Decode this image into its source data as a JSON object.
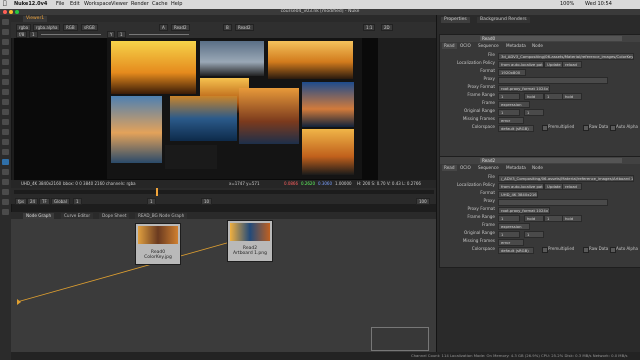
{
  "menubar": {
    "app_name": "Nuke12.0v4",
    "items": [
      "File",
      "Edit",
      "Workspace",
      "Viewer",
      "Render",
      "Cache",
      "Help"
    ],
    "clock": "Wed 10:54",
    "battery": "100%"
  },
  "window": {
    "title": "course04_v03.nk [modified] - Nuke"
  },
  "viewer_tabs": {
    "active": "Viewer1"
  },
  "viewer_controls": {
    "channels": "rgba",
    "layer": "rgba.alpha",
    "colorspace": "RGB",
    "input_a": "A",
    "input_a_node": "Read2",
    "input_b": "B",
    "input_b_node": "Read2",
    "lut": "sRGB",
    "zoom": "Fit",
    "proxy": "1:1",
    "frame_mode": "2D",
    "gain_label": "f/8",
    "gain": "1",
    "gamma_label": "Y",
    "gamma": "1"
  },
  "viewer_status": {
    "format": "UHD_4K 3840x2160",
    "bbox": "bbox: 0 0 3840 2160 channels: rgba",
    "coords": "x=1747 y=571",
    "r": "0.0866",
    "g": "0.2620",
    "b": "0.3060",
    "a": "1.00000",
    "hsv": "H: 200 S: 0.70 V: 0.43 L: 0.2766"
  },
  "timeline": {
    "fps_label": "fps",
    "fps": "24",
    "tc": "TF",
    "range": "Global",
    "start": "1",
    "end": "100",
    "current": "1",
    "step": "10"
  },
  "graph_tabs": [
    {
      "label": "Node Graph",
      "active": true
    },
    {
      "label": "Curve Editor",
      "active": false
    },
    {
      "label": "Dope Sheet",
      "active": false
    },
    {
      "label": "READ_BG Node Graph",
      "active": false
    }
  ],
  "nodes": [
    {
      "name": "Read0",
      "file": "ColorKey.jpg"
    },
    {
      "name": "Read2",
      "file": "Artboard 1.png"
    }
  ],
  "properties": {
    "tabs": [
      {
        "label": "Properties",
        "active": true
      },
      {
        "label": "Background Renders",
        "active": false
      }
    ],
    "panels": [
      {
        "name": "Read0",
        "subtabs": [
          "Read",
          "OCIO",
          "Sequence",
          "Metadata",
          "Node"
        ],
        "fields": [
          {
            "label": "File",
            "value": "3d_ADV3_Compositing/06-assets/Material/reference_images/ColorKey.jpg"
          },
          {
            "label": "Localization Policy",
            "value": "from auto-localize path",
            "extra": "Update",
            "extra2": "reload"
          },
          {
            "label": "Format",
            "value": "1920x800"
          },
          {
            "label": "Proxy",
            "value": ""
          },
          {
            "label": "Proxy Format",
            "value": "root.proxy_format 1024x778"
          },
          {
            "label": "Frame Range",
            "value": "1",
            "extra": "hold",
            "extra2": "1",
            "extra3": "hold"
          },
          {
            "label": "Frame",
            "value": "expression"
          },
          {
            "label": "Original Range",
            "value": "1",
            "extra": "1"
          },
          {
            "label": "Missing Frames",
            "value": "error"
          },
          {
            "label": "Colorspace",
            "value": "default (sRGB)",
            "extra": "Premultiplied",
            "extra2": "Raw Data",
            "extra3": "Auto Alpha"
          }
        ]
      },
      {
        "name": "Read2",
        "subtabs": [
          "Read",
          "OCIO",
          "Sequence",
          "Metadata",
          "Node"
        ],
        "fields": [
          {
            "label": "File",
            "value": "/_ADV3_Compositing/06-assets/Material/reference_images/Artboard 1.png"
          },
          {
            "label": "Localization Policy",
            "value": "from auto-localize path",
            "extra": "Update",
            "extra2": "reload"
          },
          {
            "label": "Format",
            "value": "UHD_4K 3840x2160"
          },
          {
            "label": "Proxy",
            "value": ""
          },
          {
            "label": "Proxy Format",
            "value": "root.proxy_format 1024x778"
          },
          {
            "label": "Frame Range",
            "value": "1",
            "extra": "hold",
            "extra2": "1",
            "extra3": "hold"
          },
          {
            "label": "Frame",
            "value": "expression"
          },
          {
            "label": "Original Range",
            "value": "1",
            "extra": "1"
          },
          {
            "label": "Missing Frames",
            "value": "error"
          },
          {
            "label": "Colorspace",
            "value": "default (sRGB)",
            "extra": "Premultiplied",
            "extra2": "Raw Data",
            "extra3": "Auto Alpha"
          }
        ]
      }
    ]
  },
  "statusbar": {
    "text": "Channel Count: 114  Localization Mode: On  Memory: 4.3 GB (26.9%)  CPU: 25.2%  Disk: 0.3 MB/s  Network: 0.0 MB/s"
  },
  "colors": {
    "accent": "#f0a43a",
    "node_bg": "#b9b9b9",
    "graph_bg": "#3b3b3b"
  }
}
